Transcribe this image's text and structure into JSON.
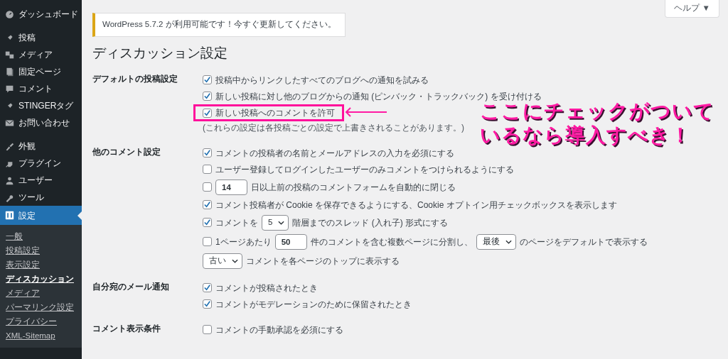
{
  "help_tab": {
    "label": "ヘルプ",
    "caret": "▼"
  },
  "sidebar": {
    "groups": [
      {
        "items": [
          {
            "label": "ダッシュボード",
            "selected": false
          }
        ]
      },
      {
        "items": [
          {
            "label": "投稿",
            "selected": false
          },
          {
            "label": "メディア",
            "selected": false
          },
          {
            "label": "固定ページ",
            "selected": false
          },
          {
            "label": "コメント",
            "selected": false
          },
          {
            "label": "STINGERタグ",
            "selected": false
          },
          {
            "label": "お問い合わせ",
            "selected": false
          }
        ]
      },
      {
        "items": [
          {
            "label": "外観",
            "selected": false
          },
          {
            "label": "プラグイン",
            "selected": false
          },
          {
            "label": "ユーザー",
            "selected": false
          },
          {
            "label": "ツール",
            "selected": false
          },
          {
            "label": "設定",
            "selected": true,
            "children": [
              {
                "label": "一般",
                "selected": false
              },
              {
                "label": "投稿設定",
                "selected": false
              },
              {
                "label": "表示設定",
                "selected": false
              },
              {
                "label": "ディスカッション",
                "selected": true
              },
              {
                "label": "メディア",
                "selected": false
              },
              {
                "label": "パーマリンク設定",
                "selected": false
              },
              {
                "label": "プライバシー",
                "selected": false
              },
              {
                "label": "XML-Sitemap",
                "selected": false
              }
            ]
          }
        ]
      }
    ]
  },
  "notice": {
    "link": "WordPress 5.7.2",
    "text": " が利用可能です！",
    "action_link": "今すぐ更新してください",
    "end": "。"
  },
  "title": "ディスカッション設定",
  "sections": [
    {
      "label": "デフォルトの投稿設定",
      "rows": [
        {
          "highlighted": false,
          "parts": [
            {
              "kind": "checkbox",
              "checked": true
            },
            {
              "kind": "text",
              "text": "投稿中からリンクしたすべてのブログへの通知を試みる"
            }
          ]
        },
        {
          "highlighted": false,
          "parts": [
            {
              "kind": "checkbox",
              "checked": true
            },
            {
              "kind": "text",
              "text": "新しい投稿に対し他のブログからの通知 (ピンバック・トラックバック) を受け付ける"
            }
          ]
        },
        {
          "highlighted": true,
          "parts": [
            {
              "kind": "checkbox",
              "checked": true
            },
            {
              "kind": "text",
              "text": "新しい投稿へのコメントを許可"
            }
          ]
        }
      ],
      "note": "(これらの設定は各投稿ごとの設定で上書きされることがあります。)"
    },
    {
      "label": "他のコメント設定",
      "rows": [
        {
          "highlighted": false,
          "parts": [
            {
              "kind": "checkbox",
              "checked": true
            },
            {
              "kind": "text",
              "text": "コメントの投稿者の名前とメールアドレスの入力を必須にする"
            }
          ]
        },
        {
          "highlighted": false,
          "parts": [
            {
              "kind": "checkbox",
              "checked": false
            },
            {
              "kind": "text",
              "text": "ユーザー登録してログインしたユーザーのみコメントをつけられるようにする"
            }
          ]
        },
        {
          "highlighted": false,
          "parts": [
            {
              "kind": "checkbox",
              "checked": false
            },
            {
              "kind": "input",
              "value": "14"
            },
            {
              "kind": "text",
              "text": "日以上前の投稿のコメントフォームを自動的に閉じる"
            }
          ]
        },
        {
          "highlighted": false,
          "parts": [
            {
              "kind": "checkbox",
              "checked": true
            },
            {
              "kind": "text",
              "text": "コメント投稿者が Cookie を保存できるようにする、Cookie オプトイン用チェックボックスを表示します"
            }
          ]
        },
        {
          "highlighted": false,
          "parts": [
            {
              "kind": "checkbox",
              "checked": true
            },
            {
              "kind": "text",
              "text": "コメントを"
            },
            {
              "kind": "select",
              "value": "5"
            },
            {
              "kind": "text",
              "text": "階層までのスレッド (入れ子) 形式にする"
            }
          ]
        },
        {
          "highlighted": false,
          "parts": [
            {
              "kind": "checkbox",
              "checked": false
            },
            {
              "kind": "text",
              "text": "1ページあたり"
            },
            {
              "kind": "input",
              "value": "50"
            },
            {
              "kind": "text",
              "text": "件のコメントを含む複数ページに分割し、"
            },
            {
              "kind": "select",
              "value": "最後"
            },
            {
              "kind": "text",
              "text": "のページをデフォルトで表示する"
            }
          ]
        },
        {
          "highlighted": false,
          "parts": [
            {
              "kind": "select",
              "value": "古い"
            },
            {
              "kind": "text",
              "text": "コメントを各ページのトップに表示する"
            }
          ]
        }
      ]
    },
    {
      "label": "自分宛のメール通知",
      "rows": [
        {
          "highlighted": false,
          "parts": [
            {
              "kind": "checkbox",
              "checked": true
            },
            {
              "kind": "text",
              "text": "コメントが投稿されたとき"
            }
          ]
        },
        {
          "highlighted": false,
          "parts": [
            {
              "kind": "checkbox",
              "checked": true
            },
            {
              "kind": "text",
              "text": "コメントがモデレーションのために保留されたとき"
            }
          ]
        }
      ]
    },
    {
      "label": "コメント表示条件",
      "rows": [
        {
          "highlighted": false,
          "parts": [
            {
              "kind": "checkbox",
              "checked": false
            },
            {
              "kind": "text",
              "text": "コメントの手動承認を必須にする"
            }
          ]
        }
      ]
    }
  ],
  "annotation": {
    "lines": [
      "ここにチェックがついて",
      "いるなら導入すべき！"
    ]
  }
}
